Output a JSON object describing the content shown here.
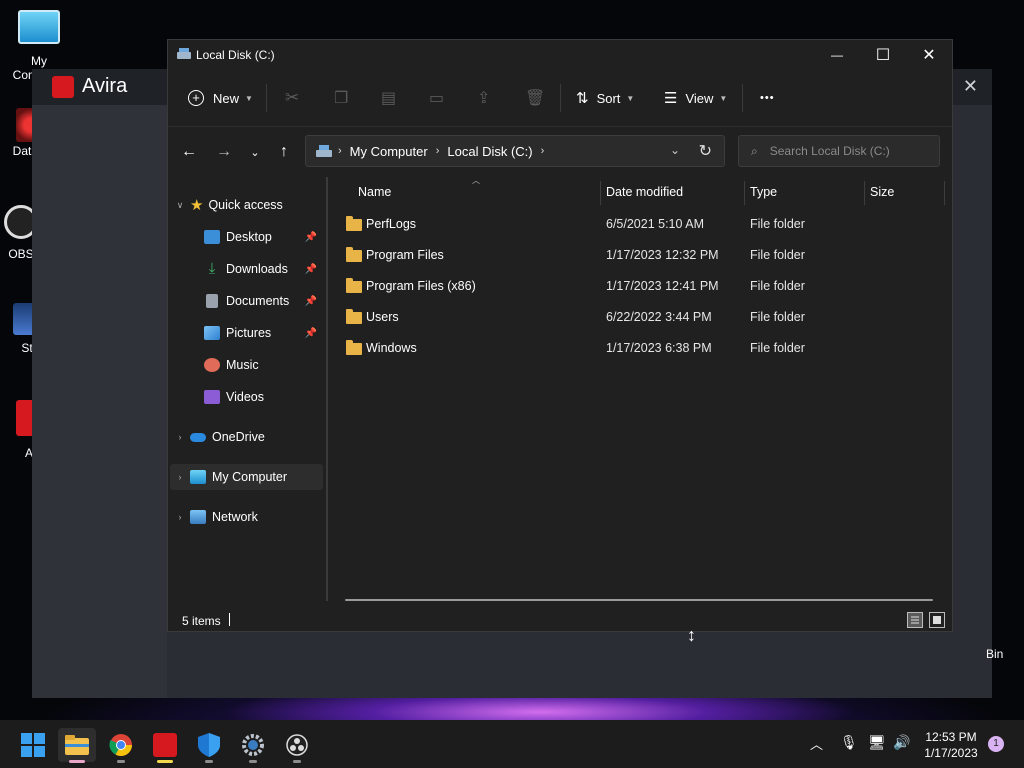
{
  "desktop": {
    "icons": [
      {
        "label": "My Computer"
      },
      {
        "label": "DataW"
      },
      {
        "label": "OBS"
      },
      {
        "label": "St"
      },
      {
        "label": "A"
      }
    ],
    "bin_label": "Bin"
  },
  "avira": {
    "title": "Avira",
    "close": "✕"
  },
  "explorer": {
    "title": "Local Disk (C:)",
    "window_controls": {
      "minimize": "—",
      "maximize": "☐",
      "close": "✕"
    },
    "toolbar": {
      "new_label": "New",
      "sort_label": "Sort",
      "view_label": "View",
      "more_label": "•••"
    },
    "address": {
      "crumbs": [
        "My Computer",
        "Local Disk (C:)"
      ]
    },
    "search": {
      "placeholder": "Search Local Disk (C:)"
    },
    "nav": {
      "quick_access": "Quick access",
      "items": [
        {
          "label": "Desktop",
          "color": "#3b8fd8"
        },
        {
          "label": "Downloads",
          "color": "#3fb36b"
        },
        {
          "label": "Documents",
          "color": "#9aa3ad"
        },
        {
          "label": "Pictures",
          "color": "#3b8fd8"
        },
        {
          "label": "Music",
          "color": "#e06b58"
        },
        {
          "label": "Videos",
          "color": "#8c5bd6"
        }
      ],
      "onedrive": "OneDrive",
      "my_computer": "My Computer",
      "network": "Network"
    },
    "columns": {
      "name": "Name",
      "date": "Date modified",
      "type": "Type",
      "size": "Size"
    },
    "files": [
      {
        "name": "PerfLogs",
        "date": "6/5/2021 5:10 AM",
        "type": "File folder"
      },
      {
        "name": "Program Files",
        "date": "1/17/2023 12:32 PM",
        "type": "File folder"
      },
      {
        "name": "Program Files (x86)",
        "date": "1/17/2023 12:41 PM",
        "type": "File folder"
      },
      {
        "name": "Users",
        "date": "6/22/2022 3:44 PM",
        "type": "File folder"
      },
      {
        "name": "Windows",
        "date": "1/17/2023 6:38 PM",
        "type": "File folder"
      }
    ],
    "status": {
      "count": "5 items"
    }
  },
  "taskbar": {
    "clock_time": "12:53 PM",
    "clock_date": "1/17/2023",
    "notification_count": "1"
  }
}
